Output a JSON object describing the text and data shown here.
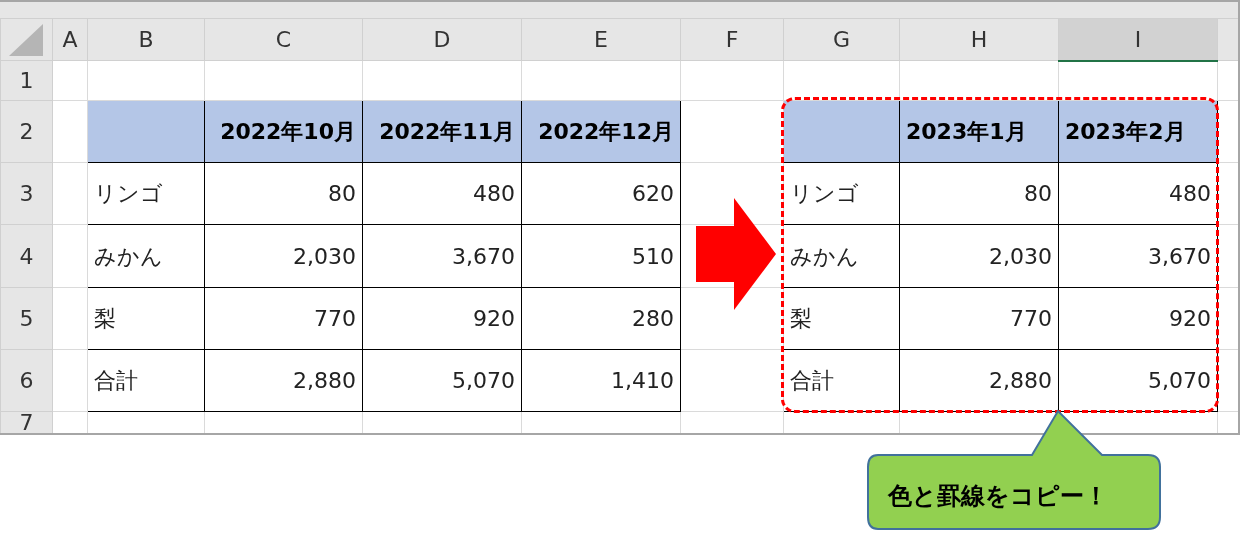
{
  "sheet": {
    "column_headers": [
      {
        "label": "A",
        "selected": false
      },
      {
        "label": "B",
        "selected": false
      },
      {
        "label": "C",
        "selected": false
      },
      {
        "label": "D",
        "selected": false
      },
      {
        "label": "E",
        "selected": false
      },
      {
        "label": "F",
        "selected": false
      },
      {
        "label": "G",
        "selected": false
      },
      {
        "label": "H",
        "selected": false
      },
      {
        "label": "I",
        "selected": true
      }
    ],
    "row_headers": [
      "1",
      "2",
      "3",
      "4",
      "5",
      "6",
      "7"
    ],
    "tables": [
      {
        "months": [
          "2022年10月",
          "2022年11月",
          "2022年12月"
        ],
        "rows": [
          {
            "label": "リンゴ",
            "values": [
              "80",
              "480",
              "620"
            ]
          },
          {
            "label": "みかん",
            "values": [
              "2,030",
              "3,670",
              "510"
            ]
          },
          {
            "label": "梨",
            "values": [
              "770",
              "920",
              "280"
            ]
          },
          {
            "label": "合計",
            "values": [
              "2,880",
              "5,070",
              "1,410"
            ]
          }
        ]
      },
      {
        "months": [
          "2023年1月",
          "2023年2月"
        ],
        "headers_left_aligned": true,
        "rows": [
          {
            "label": "リンゴ",
            "values": [
              "80",
              "480"
            ]
          },
          {
            "label": "みかん",
            "values": [
              "2,030",
              "3,670"
            ]
          },
          {
            "label": "梨",
            "values": [
              "770",
              "920"
            ]
          },
          {
            "label": "合計",
            "values": [
              "2,880",
              "5,070"
            ]
          }
        ]
      }
    ]
  },
  "callout": {
    "text": "色と罫線をコピー！"
  }
}
